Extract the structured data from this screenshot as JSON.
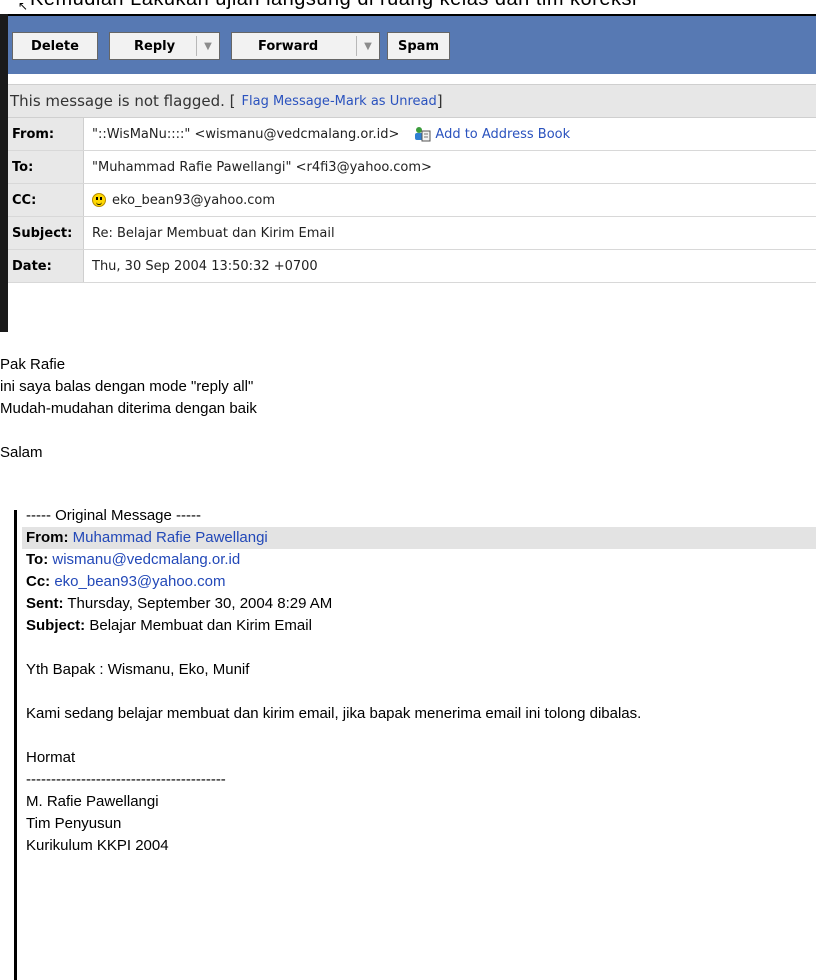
{
  "top_strip": {
    "partial_text": "Kemudian Lakukan ujian langsung di ruang kelas dan tim koreksi"
  },
  "toolbar": {
    "delete_label": "Delete",
    "reply_label": "Reply",
    "forward_label": "Forward",
    "spam_label": "Spam",
    "dropdown_glyph": "▼"
  },
  "flag": {
    "status_text": "This message is not flagged. [",
    "flag_link": "Flag Message",
    "separator": " - ",
    "unread_link": "Mark as Unread",
    "close_bracket": " ]"
  },
  "headers": {
    "from_label": "From:",
    "from_value": "\"::WisMaNu::::\" <wismanu@vedcmalang.or.id>",
    "add_book_label": "Add to Address Book",
    "to_label": "To:",
    "to_value": "\"Muhammad Rafie Pawellangi\" <r4fi3@yahoo.com>",
    "cc_label": "CC:",
    "cc_value": "eko_bean93@yahoo.com",
    "subject_label": "Subject:",
    "subject_value": "Re: Belajar Membuat dan Kirim Email",
    "date_label": "Date:",
    "date_value": "Thu, 30 Sep 2004 13:50:32 +0700"
  },
  "body": {
    "line1": "Pak Rafie",
    "line2": "ini saya balas dengan mode \"reply all\"",
    "line3": "Mudah-mudahan diterima dengan baik",
    "line4": "Salam"
  },
  "original": {
    "header": "----- Original Message -----",
    "from_label": "From:",
    "from_value": " Muhammad Rafie Pawellangi",
    "to_label": "To:",
    "to_value": " wismanu@vedcmalang.or.id",
    "cc_label": "Cc:",
    "cc_value": " eko_bean93@yahoo.com",
    "sent_label": "Sent:",
    "sent_value": " Thursday, September 30, 2004 8:29 AM",
    "subject_label": "Subject:",
    "subject_value": " Belajar Membuat dan Kirim Email",
    "greeting": "Yth Bapak : Wismanu, Eko, Munif",
    "message": "Kami sedang belajar membuat dan kirim email, jika bapak menerima email ini tolong dibalas.",
    "closing": "Hormat",
    "divider": "----------------------------------------",
    "sig_name": "M. Rafie Pawellangi",
    "sig_title": "Tim Penyusun",
    "sig_org": "Kurikulum KKPI 2004"
  },
  "colors": {
    "toolbar_bg": "#5779b3",
    "link": "#2a52be",
    "label_bg": "#e8e8e8"
  }
}
